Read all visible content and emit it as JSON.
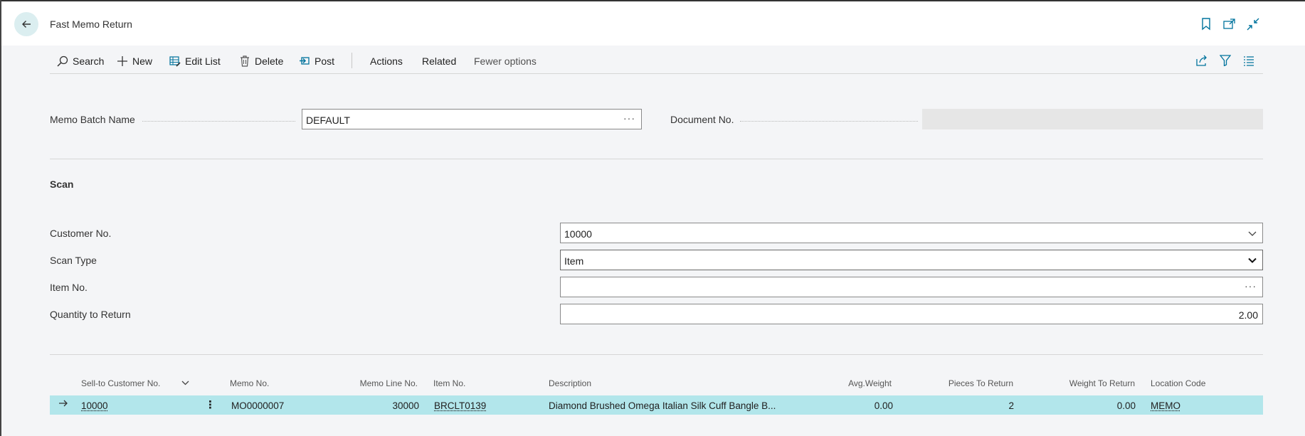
{
  "header": {
    "title": "Fast Memo Return",
    "icons": [
      "back-arrow-icon",
      "bookmark-icon",
      "open-new-window-icon",
      "collapse-icon"
    ]
  },
  "actions": {
    "search": "Search",
    "new": "New",
    "edit_list": "Edit List",
    "delete": "Delete",
    "post": "Post",
    "actions": "Actions",
    "related": "Related",
    "fewer_options": "Fewer options"
  },
  "general": {
    "memo_batch_name_label": "Memo Batch Name",
    "memo_batch_name_value": "DEFAULT",
    "document_no_label": "Document No.",
    "document_no_value": ""
  },
  "scan": {
    "title": "Scan",
    "customer_no_label": "Customer No.",
    "customer_no_value": "10000",
    "scan_type_label": "Scan Type",
    "scan_type_value": "Item",
    "item_no_label": "Item No.",
    "item_no_value": "",
    "quantity_label": "Quantity to Return",
    "quantity_value": "2.00"
  },
  "lines": {
    "columns": [
      "Sell-to Customer No.",
      "Memo No.",
      "Memo Line No.",
      "Item No.",
      "Description",
      "Avg.Weight",
      "Pieces To Return",
      "Weight To Return",
      "Location Code"
    ],
    "rows": [
      {
        "sell_to_customer_no": "10000",
        "memo_no": "MO0000007",
        "memo_line_no": "30000",
        "item_no": "BRCLT0139",
        "description": "Diamond Brushed Omega Italian Silk Cuff Bangle B...",
        "avg_weight": "0.00",
        "pieces_to_return": "2",
        "weight_to_return": "0.00",
        "location_code": "MEMO"
      }
    ]
  },
  "colors": {
    "accent": "#00a3b5",
    "selected_row": "#b2e6eb",
    "back_button": "#dbeef0"
  }
}
